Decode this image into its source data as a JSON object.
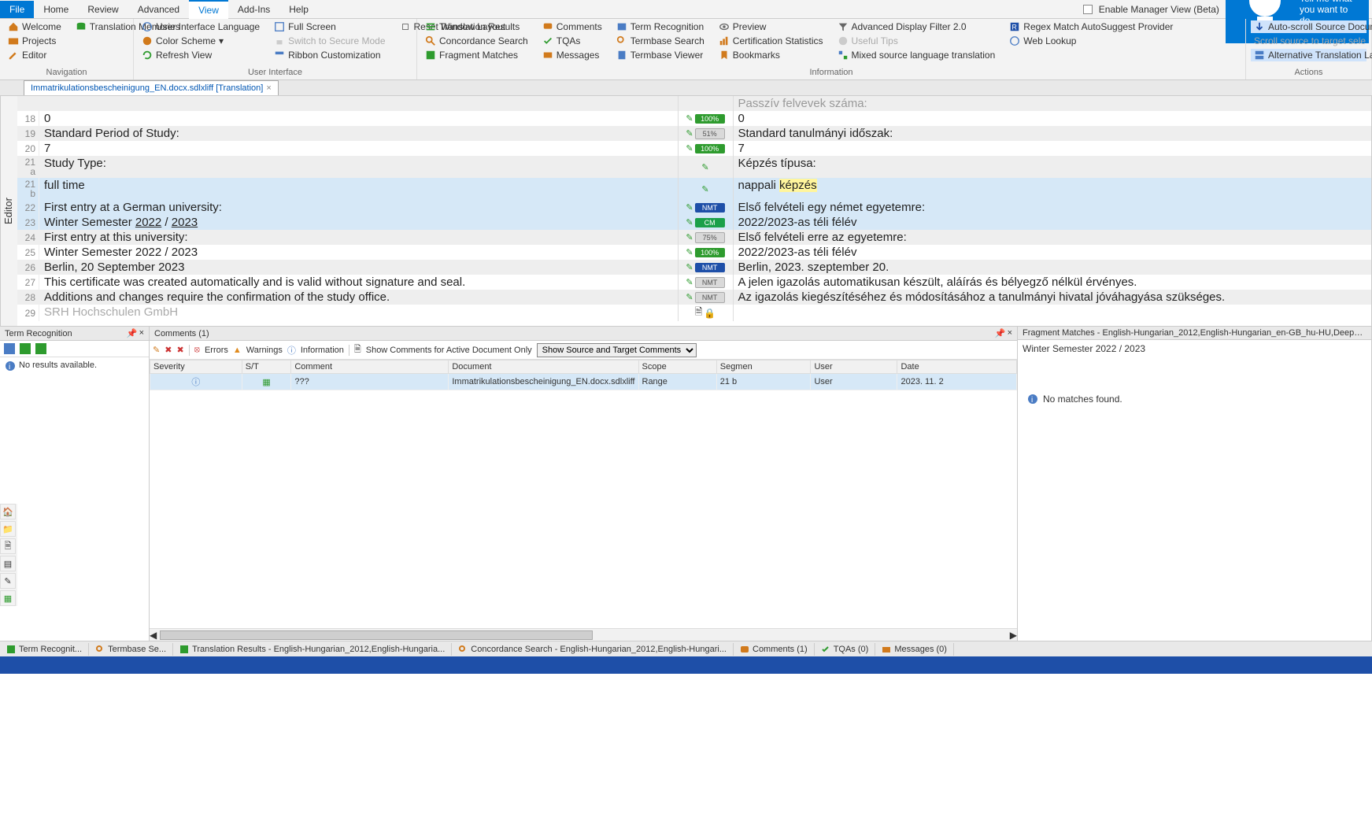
{
  "menu": {
    "file": "File",
    "home": "Home",
    "review": "Review",
    "advanced": "Advanced",
    "view": "View",
    "addins": "Add-Ins",
    "help": "Help",
    "enable_manager": "Enable Manager View (Beta)",
    "tell_me": "Tell me what you want to do..."
  },
  "ribbon": {
    "navigation": {
      "welcome": "Welcome",
      "tm": "Translation Memories",
      "projects": "Projects",
      "editor": "Editor",
      "label": "Navigation"
    },
    "ui": {
      "uilang": "User Interface Language",
      "fullscreen": "Full Screen",
      "colorscheme": "Color Scheme",
      "secure": "Switch to Secure Mode",
      "refresh": "Refresh View",
      "ribboncustom": "Ribbon Customization",
      "reset": "Reset Window Layout",
      "label": "User Interface"
    },
    "info": {
      "transresults": "Translation Results",
      "comments": "Comments",
      "termrecog": "Term Recognition",
      "preview": "Preview",
      "advfilter": "Advanced Display Filter 2.0",
      "regex": "Regex Match AutoSuggest Provider",
      "concord": "Concordance Search",
      "tqas": "TQAs",
      "termsearch": "Termbase Search",
      "certstats": "Certification Statistics",
      "useful": "Useful Tips",
      "weblookup": "Web Lookup",
      "fragmatch": "Fragment Matches",
      "messages": "Messages",
      "termview": "Termbase Viewer",
      "bookmarks": "Bookmarks",
      "mixed": "Mixed source language translation",
      "label": "Information"
    },
    "actions": {
      "autoscroll": "Auto-scroll Source Docum",
      "scrollsrc": "Scroll source to target sele",
      "altlayout": "Alternative Translation Lay",
      "label": "Actions"
    }
  },
  "doc_tab": "Immatrikulationsbescheinigung_EN.docx.sdlxliff [Translation]",
  "segments": [
    {
      "n": "18",
      "src": "0",
      "st": "100%",
      "stc": "pill-100",
      "tgt": "0",
      "alt": false
    },
    {
      "n": "19",
      "src": "Standard Period of Study:",
      "st": "51%",
      "stc": "pill-51",
      "tgt": "Standard tanulmányi időszak:",
      "alt": true
    },
    {
      "n": "20",
      "src": "7",
      "st": "100%",
      "stc": "pill-100",
      "tgt": "7",
      "alt": false
    },
    {
      "n": "21\na",
      "src": "Study Type:",
      "st": "",
      "stc": "",
      "tgt": "Képzés típusa:",
      "alt": true
    },
    {
      "n": "21\nb",
      "src": "full time",
      "st": "",
      "stc": "",
      "tgt": "nappali <span class='hl-yellow'>képzés</span>",
      "alt": false,
      "sel": true
    },
    {
      "n": "22",
      "src": "First entry at a German university:",
      "st": "NMT",
      "stc": "pill-nmt",
      "tgt": "Első felvételi egy német egyetemre:",
      "alt": true,
      "sel": true
    },
    {
      "n": "23",
      "src": "Winter Semester <span class='underlined'>2022</span> / <span class='underlined'>2023</span>",
      "st": "CM",
      "stc": "pill-cm",
      "tgt": "2022/2023-as téli félév",
      "alt": false,
      "sel": true
    },
    {
      "n": "24",
      "src": "First entry at this university:",
      "st": "75%",
      "stc": "pill-75",
      "tgt": "Első felvételi erre az egyetemre:",
      "alt": true
    },
    {
      "n": "25",
      "src": "Winter Semester 2022 / 2023",
      "st": "100%",
      "stc": "pill-100",
      "tgt": "2022/2023-as téli félév",
      "alt": false
    },
    {
      "n": "26",
      "src": "Berlin, 20 September 2023",
      "st": "NMT",
      "stc": "pill-nmt",
      "tgt": "Berlin, 2023. szeptember 20.",
      "alt": true
    },
    {
      "n": "27",
      "src": "This certificate was created automatically and is valid without signature and seal.",
      "st": "NMT",
      "stc": "pill-nmt2",
      "tgt": "A jelen igazolás automatikusan készült, aláírás és bélyegző nélkül érvényes.",
      "alt": false
    },
    {
      "n": "28",
      "src": "Additions and changes require the confirmation of the study office.",
      "st": "NMT",
      "stc": "pill-nmt2",
      "tgt": "Az igazolás kiegészítéséhez és módosításához a tanulmányi hivatal jóváhagyása szükséges.",
      "alt": true
    },
    {
      "n": "29",
      "src": "SRH Hochschulen GmbH",
      "st": "",
      "stc": "",
      "tgt": "",
      "alt": false,
      "locked": true,
      "gray": true
    }
  ],
  "passive_row_tgt_label": "Passzív felvevek száma:",
  "term_panel": {
    "title": "Term Recognition",
    "noresults": "No results available."
  },
  "comments_panel": {
    "title": "Comments (1)",
    "errors": "Errors",
    "warnings": "Warnings",
    "information": "Information",
    "showactive": "Show Comments for Active Document Only",
    "filter_sel": "Show Source and Target Comments",
    "cols": {
      "severity": "Severity",
      "st": "S/T",
      "comment": "Comment",
      "document": "Document",
      "scope": "Scope",
      "segment": "Segmen",
      "user": "User",
      "date": "Date"
    },
    "row": {
      "comment": "???",
      "document": "Immatrikulationsbescheinigung_EN.docx.sdlxliff",
      "scope": "Range",
      "segment": "21 b",
      "user": "User",
      "date": "2023. 11. 2"
    }
  },
  "frag_panel": {
    "title": "Fragment Matches - English-Hungarian_2012,English-Hungarian_en-GB_hu-HU,DeepL Translator provider us",
    "text": "Winter Semester 2022 / 2023",
    "nomatch": "No matches found."
  },
  "bottom_tabs": {
    "left1": "Term Recognit...",
    "left2": "Termbase Se...",
    "transres": "Translation Results - English-Hungarian_2012,English-Hungaria...",
    "concord": "Concordance Search - English-Hungarian_2012,English-Hungari...",
    "comments": "Comments (1)",
    "tqas": "TQAs (0)",
    "messages": "Messages (0)"
  }
}
